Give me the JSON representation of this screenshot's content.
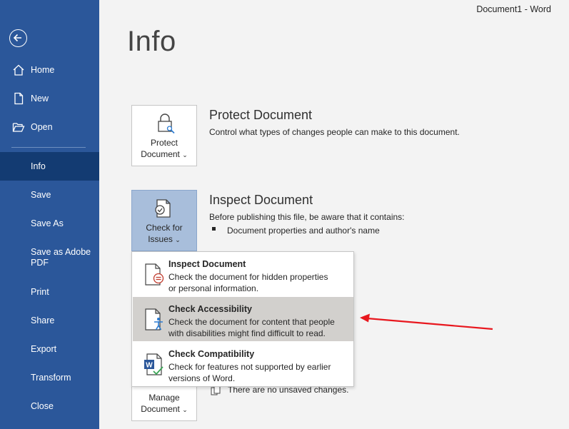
{
  "window": {
    "title": "Document1  -  Word"
  },
  "sidebar": {
    "items": [
      {
        "label": "Home",
        "icon": "home-icon"
      },
      {
        "label": "New",
        "icon": "new-document-icon"
      },
      {
        "label": "Open",
        "icon": "folder-open-icon"
      },
      {
        "label": "Info",
        "active": true
      },
      {
        "label": "Save"
      },
      {
        "label": "Save As"
      },
      {
        "label": "Save as Adobe PDF"
      },
      {
        "label": "Print"
      },
      {
        "label": "Share"
      },
      {
        "label": "Export"
      },
      {
        "label": "Transform"
      },
      {
        "label": "Close"
      }
    ]
  },
  "main": {
    "title": "Info",
    "protect": {
      "tile_line1": "Protect",
      "tile_line2": "Document",
      "title": "Protect Document",
      "description": "Control what types of changes people can make to this document."
    },
    "inspect": {
      "tile_line1": "Check for",
      "tile_line2": "Issues",
      "title": "Inspect Document",
      "description": "Before publishing this file, be aware that it contains:",
      "bullet": "Document properties and author's name"
    },
    "manage": {
      "tile_line1": "Manage",
      "tile_line2": "Document",
      "status": "There are no unsaved changes."
    }
  },
  "dropdown": {
    "items": [
      {
        "title": "Inspect Document",
        "description_line1": "Check the document for hidden properties",
        "description_line2": "or personal information."
      },
      {
        "title": "Check Accessibility",
        "description_line1": "Check the document for content that people",
        "description_line2": "with disabilities might find difficult to read.",
        "hovered": true
      },
      {
        "title": "Check Compatibility",
        "description_line1": "Check for features not supported by earlier",
        "description_line2": "versions of Word."
      }
    ]
  },
  "colors": {
    "sidebar": "#2b579a",
    "sidebar_active": "#133b72",
    "tile_selected": "#a8bedb",
    "annotation_arrow": "#e8171e"
  }
}
